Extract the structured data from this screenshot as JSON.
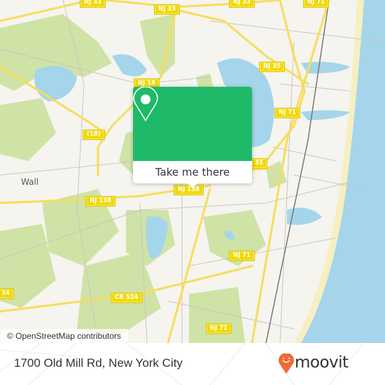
{
  "map": {
    "route_labels": [
      {
        "id": "nj33-a",
        "text": "NJ 33"
      },
      {
        "id": "nj33-b",
        "text": "NJ 33"
      },
      {
        "id": "nj33-c",
        "text": "NJ 33"
      },
      {
        "id": "nj71-top",
        "text": "NJ 71"
      },
      {
        "id": "nj35-top",
        "text": "NJ 35"
      },
      {
        "id": "nj18",
        "text": "NJ 18"
      },
      {
        "id": "nj71-mid",
        "text": "NJ 71"
      },
      {
        "id": "r18",
        "text": "(18)"
      },
      {
        "id": "nj35-mid",
        "text": "NJ 35"
      },
      {
        "id": "nj138-right",
        "text": "NJ 138"
      },
      {
        "id": "nj138-left",
        "text": "NJ 138"
      },
      {
        "id": "nj71-low",
        "text": "NJ 71"
      },
      {
        "id": "cr524",
        "text": "CR 524"
      },
      {
        "id": "r34",
        "text": "34"
      },
      {
        "id": "nj71-bottom",
        "text": "NJ 71"
      }
    ],
    "place_labels": {
      "wall": "Wall"
    },
    "attribution": "© OpenStreetMap contributors"
  },
  "popup": {
    "icon": "map-pin-icon",
    "button_label": "Take me there",
    "color": "#1fb96a"
  },
  "footer": {
    "address": "1700 Old Mill Rd, New York City",
    "brand": "moovit",
    "brand_color": "#f26a36"
  }
}
